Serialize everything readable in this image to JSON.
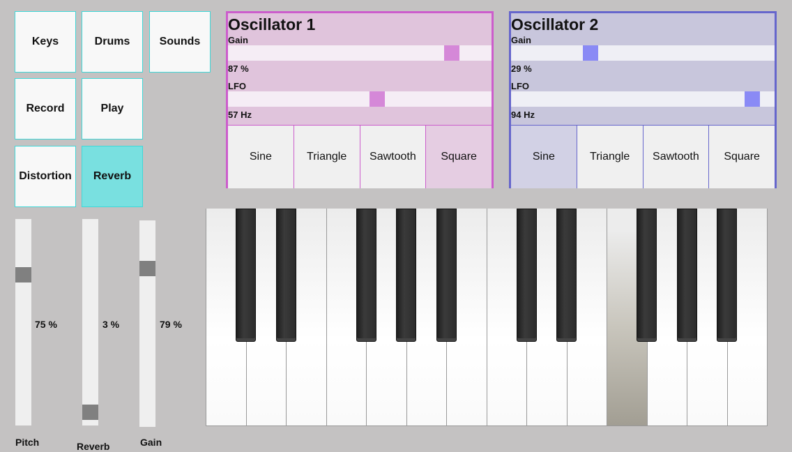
{
  "nav": {
    "keys": "Keys",
    "drums": "Drums",
    "sounds": "Sounds",
    "record": "Record",
    "play": "Play",
    "distortion": "Distortion",
    "reverb": "Reverb",
    "active": "reverb"
  },
  "master_sliders": [
    {
      "label": "Pitch",
      "value_text": "75 %",
      "value": 0.75
    },
    {
      "label": "Reverb",
      "value_text": "3 %",
      "value": 0.03
    },
    {
      "label": "Gain",
      "value_text": "79 %",
      "value": 0.79
    }
  ],
  "oscillators": [
    {
      "title": "Oscillator 1",
      "gain_label": "Gain",
      "gain_text": "87 %",
      "gain_value": 0.87,
      "lfo_label": "LFO",
      "lfo_text": "57 Hz",
      "lfo_value": 0.57,
      "waveforms": [
        "Sine",
        "Triangle",
        "Sawtooth",
        "Square"
      ],
      "selected_waveform": "Square"
    },
    {
      "title": "Oscillator 2",
      "gain_label": "Gain",
      "gain_text": "29 %",
      "gain_value": 0.29,
      "lfo_label": "LFO",
      "lfo_text": "94 Hz",
      "lfo_value": 0.94,
      "waveforms": [
        "Sine",
        "Triangle",
        "Sawtooth",
        "Square"
      ],
      "selected_waveform": "Sine"
    }
  ],
  "keyboard": {
    "white_keys": 14,
    "black_key_after_white": [
      0,
      1,
      3,
      4,
      5,
      7,
      8,
      10,
      11,
      12
    ],
    "pressed_white_key": 10
  },
  "colors": {
    "accent": "#79e0e0",
    "osc1_border": "#cc5dcc",
    "osc2_border": "#6666cc"
  }
}
